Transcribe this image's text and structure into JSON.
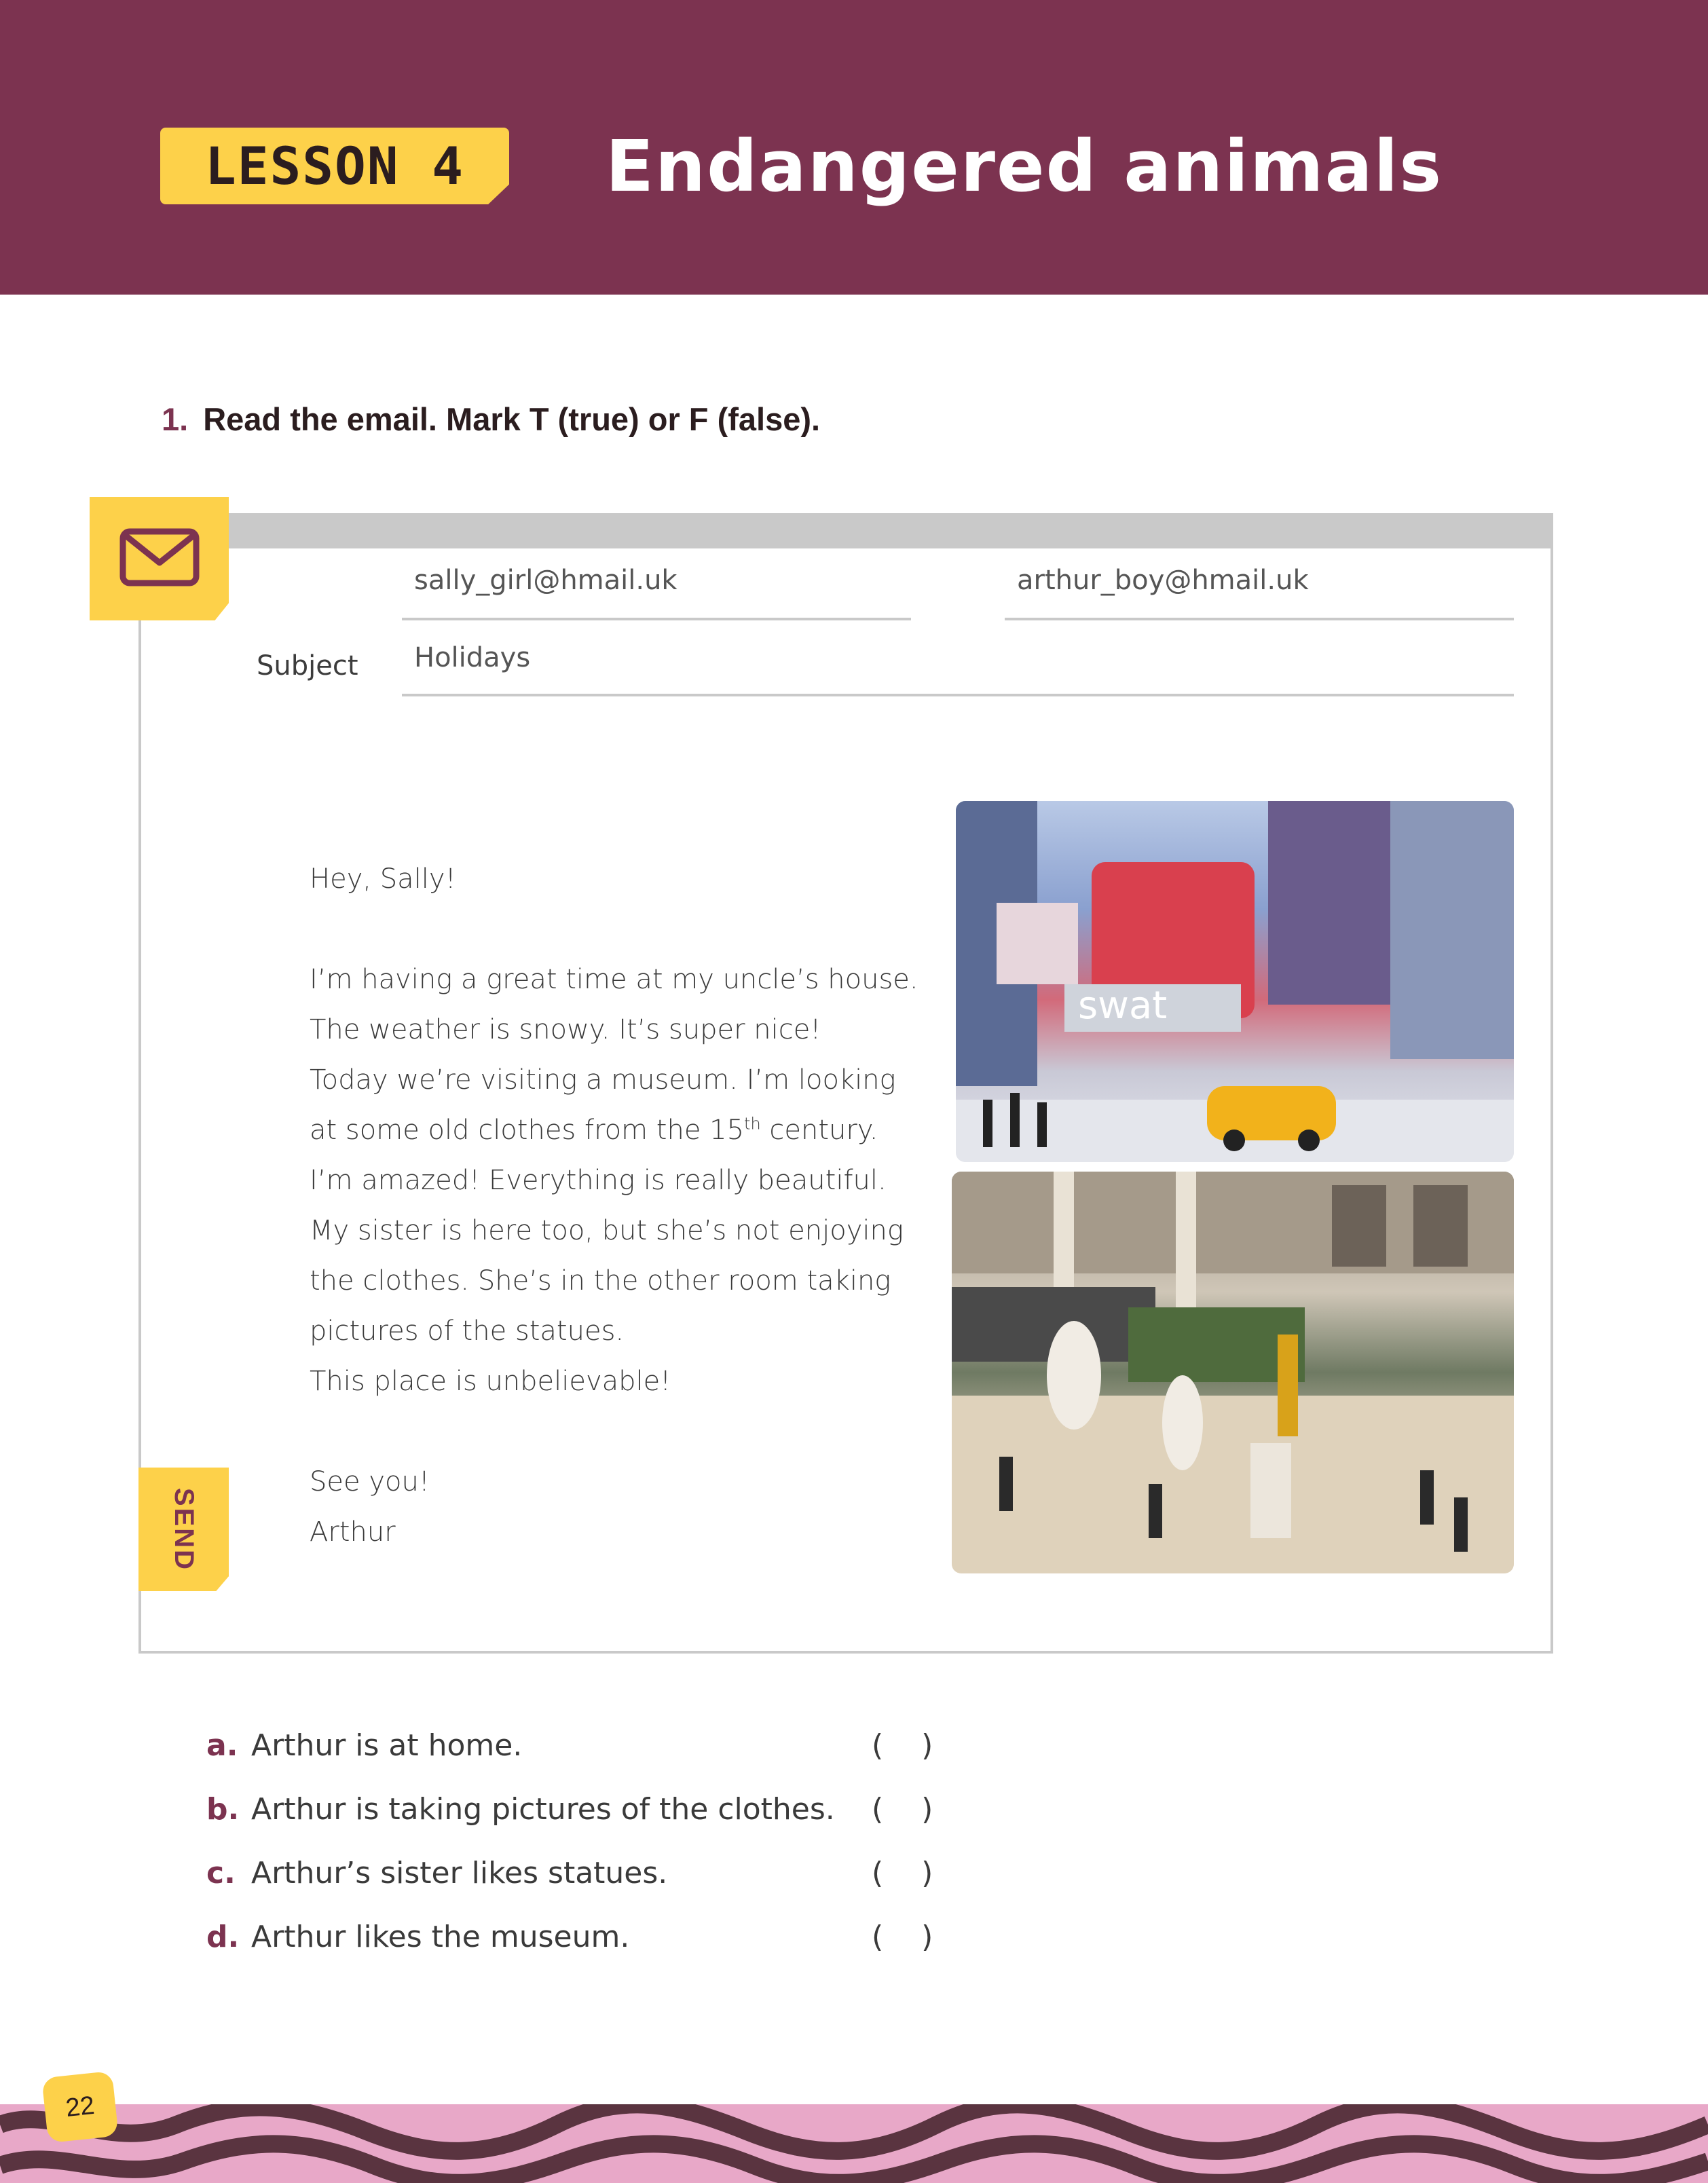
{
  "header": {
    "lesson_label": "LESSON 4",
    "title": "Endangered animals"
  },
  "exercise": {
    "number": "1.",
    "instruction": "Read the email. Mark T (true) or F (false)."
  },
  "email": {
    "from": "sally_girl@hmail.uk",
    "to": "arthur_boy@hmail.uk",
    "subject_label": "Subject",
    "subject": "Holidays",
    "send_label": "SEND",
    "greeting": "Hey, Sally!",
    "body_lines": [
      "I’m having a great time at my uncle’s house.",
      "The weather is snowy. It’s super nice!",
      "Today we’re visiting a museum. I’m looking",
      "at some old clothes from the 15",
      "I’m amazed! Everything is really beautiful.",
      "My sister is here too, but she’s not enjoying",
      "the clothes. She’s in the other room taking",
      "pictures of the statues.",
      "This place is unbelievable!"
    ],
    "superscript": "th",
    "century_suffix": " century.",
    "closing": "See you!",
    "signature": "Arthur",
    "icon": "envelope-icon"
  },
  "questions": [
    {
      "letter": "a.",
      "text": "Arthur is at home.",
      "answer_box": "(    )"
    },
    {
      "letter": "b.",
      "text": "Arthur is taking pictures of the clothes.",
      "answer_box": "(    )"
    },
    {
      "letter": "c.",
      "text": "Arthur’s sister likes statues.",
      "answer_box": "(    )"
    },
    {
      "letter": "d.",
      "text": "Arthur likes the museum.",
      "answer_box": "(    )"
    }
  ],
  "page_number": "22",
  "colors": {
    "header": "#7c3350",
    "accent_yellow": "#fdd14a",
    "footer_pink": "#e8a8c8",
    "footer_dark": "#5a3440"
  }
}
